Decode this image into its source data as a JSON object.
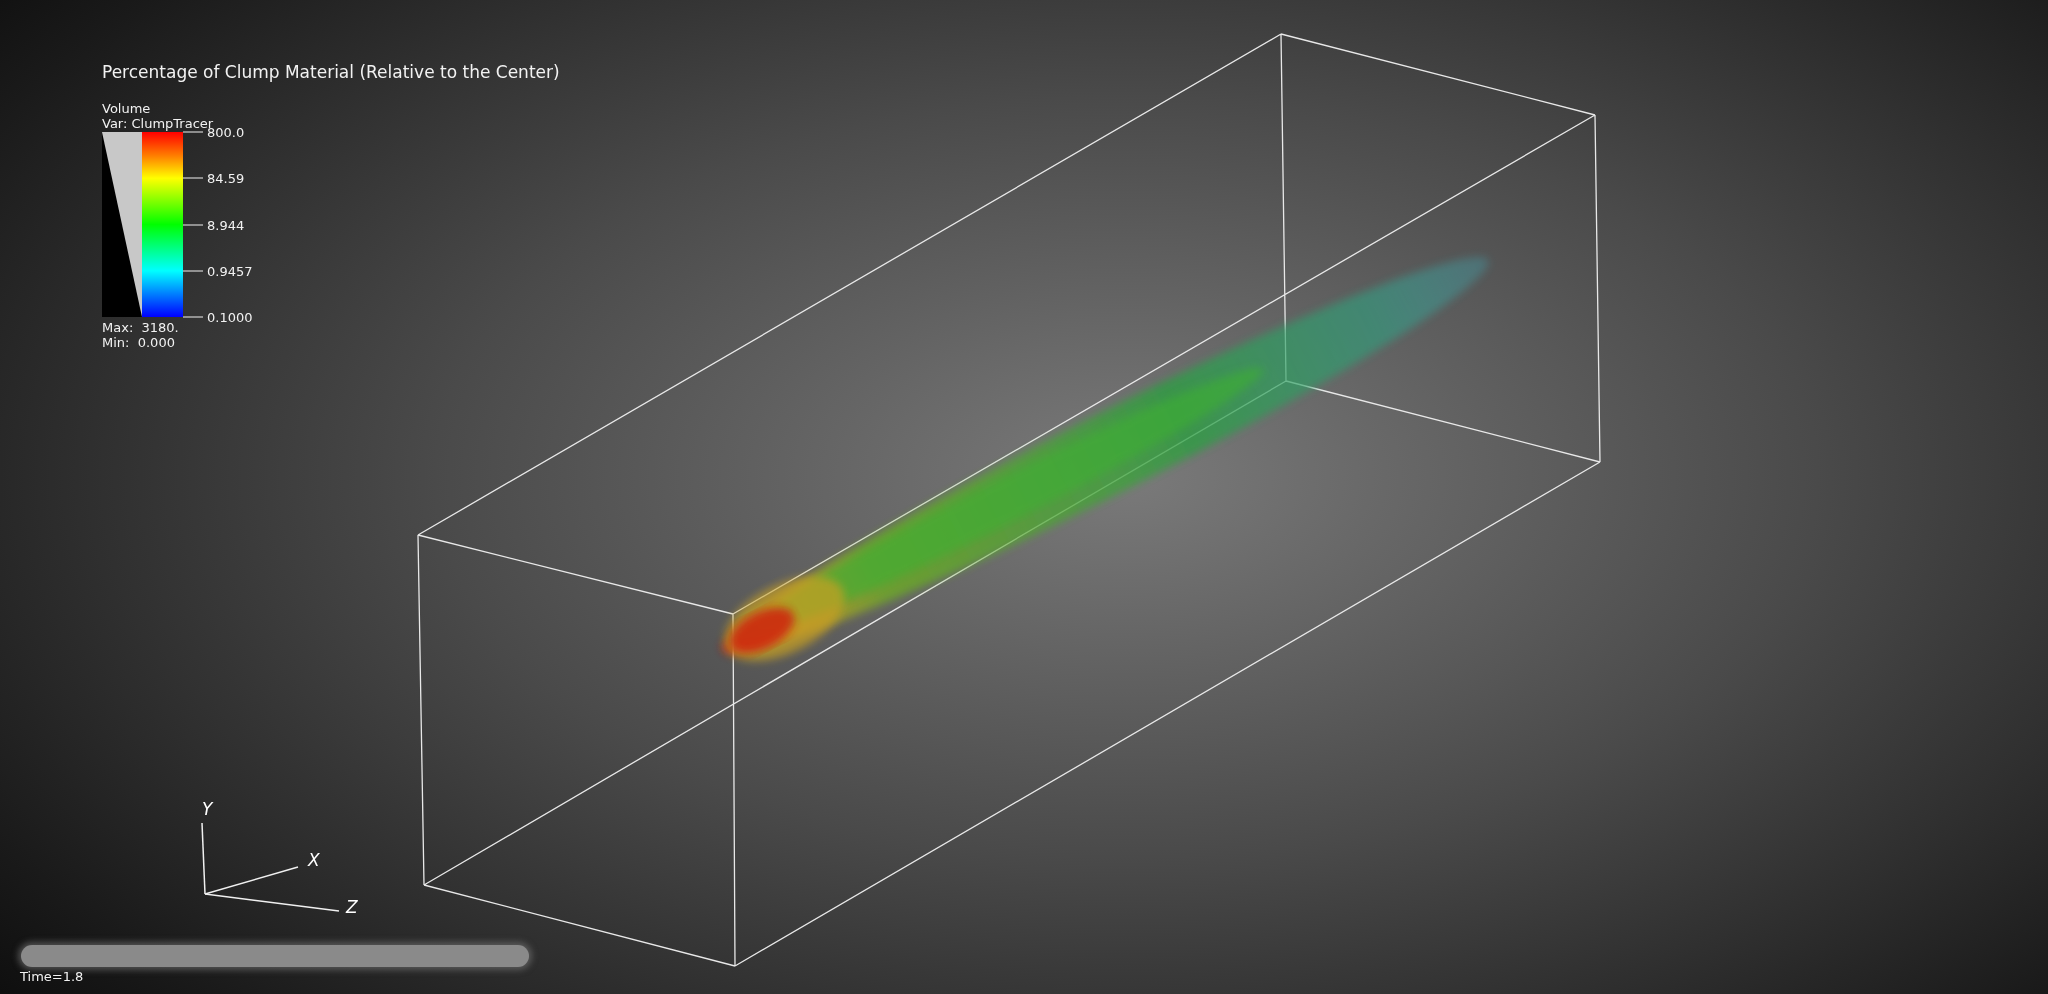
{
  "title": "Percentage of Clump Material (Relative to the Center)",
  "legend": {
    "plot_type": "Volume",
    "variable": "Var: ClumpTracer",
    "ticks": [
      "800.0",
      "84.59",
      "8.944",
      "0.9457",
      "0.1000"
    ],
    "max": "Max:  3180.",
    "min": "Min:  0.000"
  },
  "axes": [
    {
      "label": "Y"
    },
    {
      "label": "X"
    },
    {
      "label": "Z"
    }
  ],
  "time": "Time=1.8"
}
